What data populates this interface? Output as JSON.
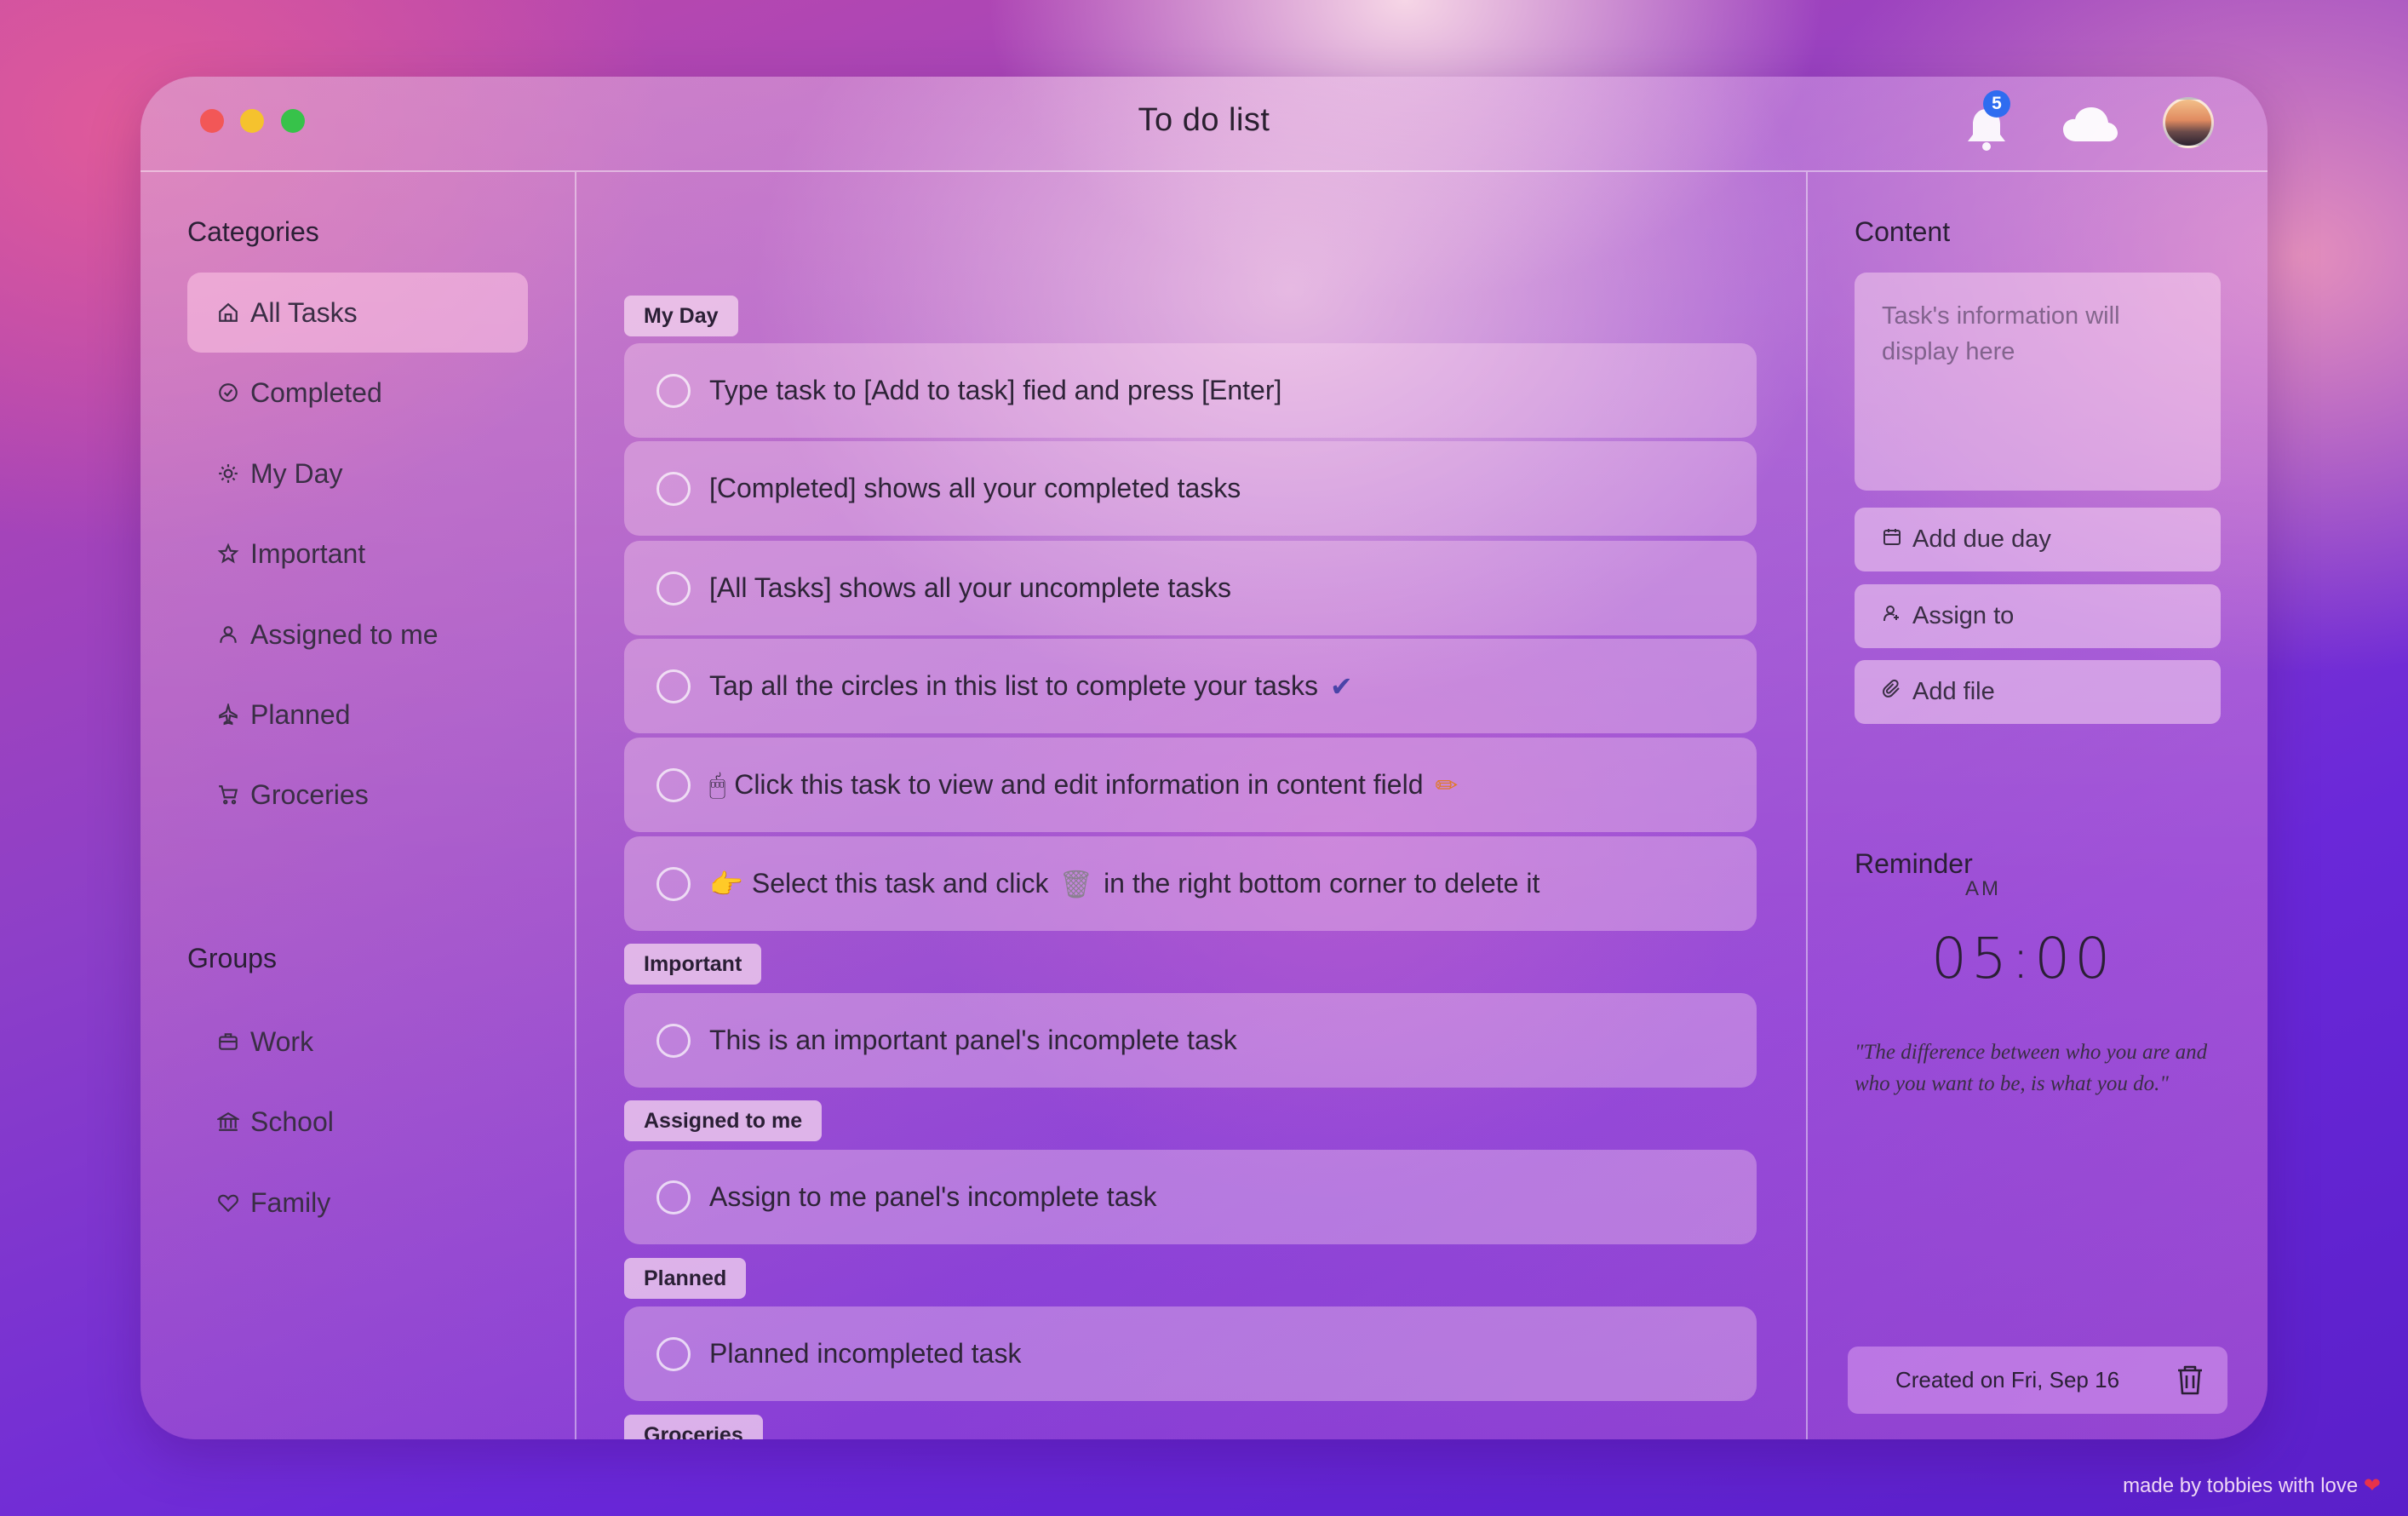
{
  "window": {
    "title": "To do list",
    "notification_count": "5"
  },
  "sidebar": {
    "categories_title": "Categories",
    "categories": [
      {
        "label": "All Tasks",
        "icon": "home-icon"
      },
      {
        "label": "Completed",
        "icon": "check-circle-icon"
      },
      {
        "label": "My Day",
        "icon": "sun-icon"
      },
      {
        "label": "Important",
        "icon": "star-icon"
      },
      {
        "label": "Assigned to me",
        "icon": "person-icon"
      },
      {
        "label": "Planned",
        "icon": "plane-icon"
      },
      {
        "label": "Groceries",
        "icon": "cart-icon"
      }
    ],
    "groups_title": "Groups",
    "groups": [
      {
        "label": "Work",
        "icon": "briefcase-icon"
      },
      {
        "label": "School",
        "icon": "institution-icon"
      },
      {
        "label": "Family",
        "icon": "heart-icon"
      }
    ],
    "active_item": "All Tasks"
  },
  "main": {
    "groups": [
      {
        "tag": "My Day",
        "tasks": [
          {
            "text": "Type task to [Add to task] fied and press [Enter]"
          },
          {
            "text": "[Completed] shows all your completed tasks"
          },
          {
            "text": "[All Tasks] shows all your uncomplete tasks"
          },
          {
            "text": "Tap all the circles in this list to complete your tasks",
            "trail": "✔"
          },
          {
            "lead": "🖱",
            "text": "Click this task to view and edit information in content field",
            "trail": "✏"
          },
          {
            "lead": "👉",
            "text": "Select this task and click",
            "mid": "🗑",
            "text2": "in the right bottom corner to delete it"
          }
        ]
      },
      {
        "tag": "Important",
        "tasks": [
          {
            "text": "This is an important panel's incomplete task"
          }
        ]
      },
      {
        "tag": "Assigned to me",
        "tasks": [
          {
            "text": "Assign to me panel's incomplete task"
          }
        ]
      },
      {
        "tag": "Planned",
        "tasks": [
          {
            "text": "Planned incompleted task"
          }
        ]
      },
      {
        "tag": "Groceries",
        "tasks": []
      }
    ]
  },
  "content_panel": {
    "title": "Content",
    "placeholder": "Task's information will display here",
    "actions": [
      {
        "label": "Add due day",
        "icon": "calendar-icon"
      },
      {
        "label": "Assign to",
        "icon": "person-add-icon"
      },
      {
        "label": "Add file",
        "icon": "paperclip-icon"
      }
    ],
    "reminder_title": "Reminder",
    "reminder_time": "05:00",
    "reminder_ampm": "AM",
    "quote": "\"The difference between who you are and who you want to be, is what you do.\""
  },
  "footer": {
    "created_label": "Created on Fri, Sep 16",
    "credit": "made by tobbies with love",
    "credit_heart": "❤"
  },
  "colors": {
    "red": "#f25757",
    "yellow": "#f5c22e",
    "green": "#37c24a",
    "badge": "#2f6cf0"
  }
}
